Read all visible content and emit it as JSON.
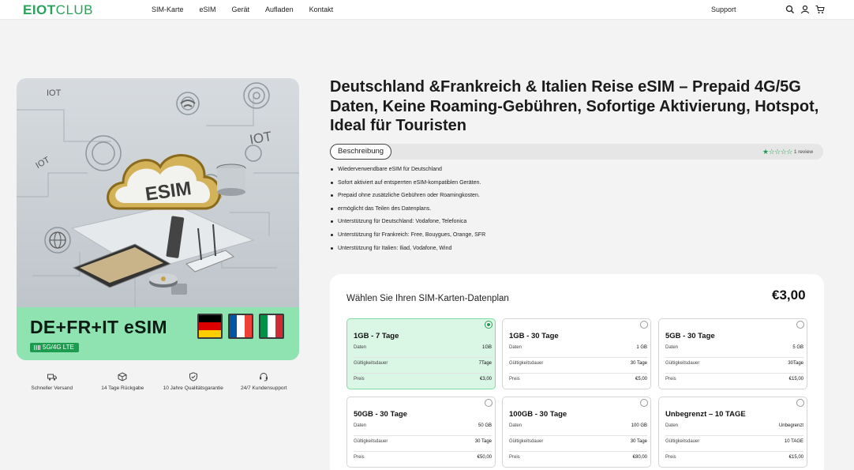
{
  "header": {
    "logo_bold": "EIOT",
    "logo_light": "CLUB",
    "nav": [
      "SIM-Karte",
      "eSIM",
      "Gerät",
      "Aufladen",
      "Kontakt"
    ],
    "support": "Support",
    "icons": [
      "search-icon",
      "user-icon",
      "cart-icon"
    ]
  },
  "product_image": {
    "banner_title": "DE+FR+IT eSIM",
    "lte_badge": "5G/4G LTE",
    "cloud_text": "ESIM",
    "iot_labels": [
      "IOT",
      "IOT",
      "IOT"
    ],
    "flags": [
      "germany-flag",
      "france-flag",
      "italy-flag"
    ]
  },
  "features": [
    {
      "icon": "truck-icon",
      "label": "Schneller Versand"
    },
    {
      "icon": "package-return-icon",
      "label": "14 Tage Rückgabe"
    },
    {
      "icon": "shield-check-icon",
      "label": "10 Jahre Qualitätsgarantie"
    },
    {
      "icon": "headset-icon",
      "label": "24/7 Kundensupport"
    }
  ],
  "product": {
    "title": "Deutschland &Frankreich & Italien Reise eSIM – Prepaid 4G/5G Daten, Keine Roaming-Gebühren, Sofortige Aktivierung, Hotspot, Ideal für Touristen",
    "tab": "Beschreibung",
    "rating_stars": 1,
    "rating_max": 5,
    "rating_stars_text": "★☆☆☆☆",
    "reviews": "1 review",
    "bullets": [
      "Wiederverwendbare eSIM für Deutschland",
      "Sofort aktiviert auf entsperrten eSIM-kompatiblen Geräten.",
      "Prepaid ohne zusätzliche Gebühren oder Roamingkosten.",
      "ermöglicht das Teilen des Datenplans.",
      "Unterstützung für Deutschland: Vodafone, Telefonica",
      "Unterstützung für Frankreich: Free, Bouygues, Orange, SFR",
      "Unterstützung für Italien: Iliad, Vodafone, Wind"
    ]
  },
  "plans": {
    "title": "Wählen Sie Ihren SIM-Karten-Datenplan",
    "price": "€3,00",
    "row_labels": {
      "data": "Daten",
      "validity": "Gültigkeitsdauer",
      "price": "Preis"
    },
    "options": [
      {
        "name": "1GB - 7 Tage",
        "data": "1GB",
        "validity": "7Tage",
        "price": "€3,00",
        "selected": true
      },
      {
        "name": "1GB - 30 Tage",
        "data": "1 GB",
        "validity": "30 Tage",
        "price": "€5,00",
        "selected": false
      },
      {
        "name": "5GB - 30 Tage",
        "data": "5 GB",
        "validity": "30Tage",
        "price": "€15,00",
        "selected": false
      },
      {
        "name": "50GB - 30 Tage",
        "data": "50 GB",
        "validity": "30 Tage",
        "price": "€50,00",
        "selected": false
      },
      {
        "name": "100GB - 30 Tage",
        "data": "100 GB",
        "validity": "30 Tage",
        "price": "€80,00",
        "selected": false
      },
      {
        "name": "Unbegrenzt – 10 TAGE",
        "data": "Unbegrenzt",
        "validity": "10 TAGE",
        "price": "€15,00",
        "selected": false
      }
    ]
  },
  "colors": {
    "brand_green": "#2aa35a",
    "banner_green": "#8fe3b0",
    "selected_bg": "#daf6e5",
    "accent": "#1d9c4f"
  }
}
